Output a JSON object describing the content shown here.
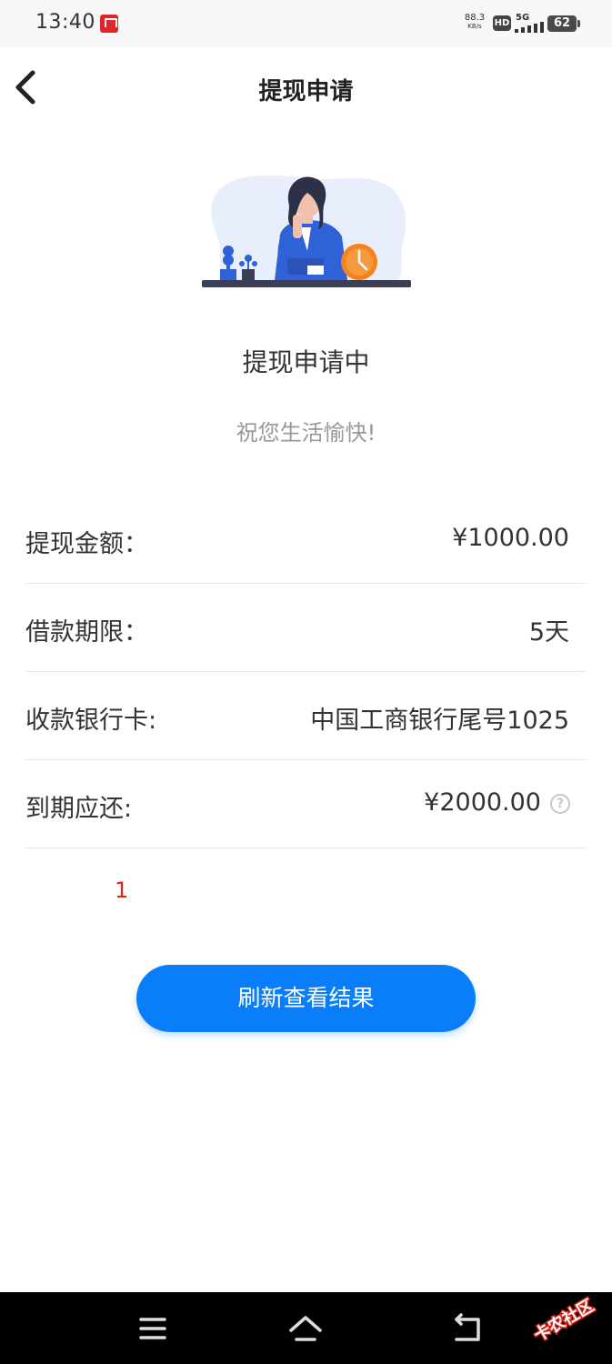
{
  "status_bar": {
    "time": "13:40",
    "speed_value": "88.3",
    "speed_unit": "KB/s",
    "hd": "HD",
    "network": "5G",
    "battery": "62"
  },
  "nav": {
    "title": "提现申请",
    "back_icon": "chevron-left-icon"
  },
  "status": {
    "title": "提现申请中",
    "subtitle": "祝您生活愉快!"
  },
  "info": [
    {
      "label": "提现金额：",
      "value": "¥1000.00"
    },
    {
      "label": "借款期限：",
      "value": "5天"
    },
    {
      "label": "收款银行卡:",
      "value": "中国工商银行尾号1025"
    },
    {
      "label": "到期应还:",
      "value": "¥2000.00"
    }
  ],
  "help_icon_text": "?",
  "note": "1",
  "refresh_button": "刷新查看结果",
  "watermark": "卡农社区",
  "colors": {
    "primary": "#0a7ef8",
    "note_red": "#d9251c",
    "illustration_blue": "#2f62d6",
    "clock_orange": "#f5821f"
  },
  "system_nav": [
    "menu-icon",
    "home-icon",
    "back-icon"
  ]
}
